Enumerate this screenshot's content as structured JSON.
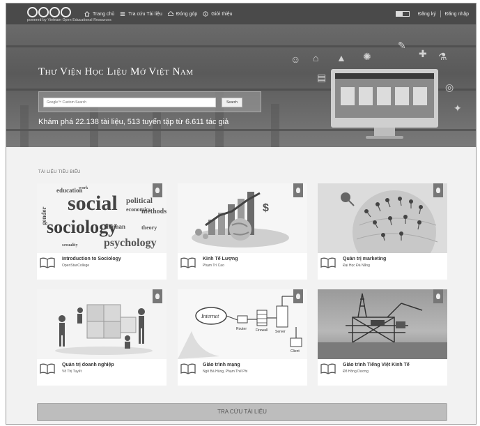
{
  "brand": {
    "logo_subtext": "powered by Vietnam Open Educational Resources"
  },
  "nav": {
    "items": [
      {
        "label": "Trang chủ",
        "icon": "home-icon"
      },
      {
        "label": "Tra cứu Tài liệu",
        "icon": "list-icon"
      },
      {
        "label": "Đóng góp",
        "icon": "cloud-icon"
      },
      {
        "label": "Giới thiệu",
        "icon": "info-icon"
      }
    ],
    "register": "Đăng ký",
    "login": "Đăng nhập"
  },
  "hero": {
    "title": "Thư Viện Học Liệu Mở Việt Nam",
    "search_placeholder": "Google™ Custom Search",
    "search_button": "Search",
    "stats": "Khám phá 22.138 tài liệu, 513 tuyển tập từ 6.611 tác giả"
  },
  "featured": {
    "heading": "TÀI LIỆU TIÊU BIỂU",
    "items": [
      {
        "title": "Introduction to Sociology",
        "author": "OpenStaxCollege"
      },
      {
        "title": "Kinh Tế Lượng",
        "author": "Phạm Trí Cao"
      },
      {
        "title": "Quản trị marketing",
        "author": "Đại Học Đà Nẵng"
      },
      {
        "title": "Quản trị doanh nghiệp",
        "author": "Võ Thị Tuyết"
      },
      {
        "title": "Giáo trình mạng",
        "author": "Ngô Bá Hùng, Phạm Thế Phi"
      },
      {
        "title": "Giáo trình Tiếng Việt Kinh Tế",
        "author": "Đỗ Hồng Dương"
      }
    ],
    "word_cloud": [
      "education",
      "gender",
      "social",
      "political",
      "sociology",
      "psychology",
      "methods",
      "economics",
      "sexuality",
      "work",
      "human",
      "theory"
    ],
    "network_labels": [
      "Internet",
      "Router",
      "Firewall",
      "Server",
      "Client"
    ]
  },
  "cta": {
    "label": "TRA CỨU TÀI LIỆU"
  },
  "colors": {
    "navbar": "#4a4a4a",
    "accent": "#777777",
    "button": "#bdbdbd"
  }
}
